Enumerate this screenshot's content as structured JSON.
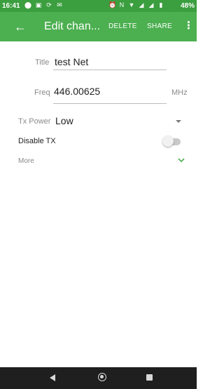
{
  "status_bar": {
    "time": "16:41",
    "battery": "48%",
    "left_icons": [
      "notification-icon",
      "image-icon",
      "sync-icon",
      "message-icon"
    ],
    "right_icons": [
      "alarm-icon",
      "nfc-icon",
      "wifi-icon",
      "signal-icon",
      "signal-icon",
      "battery-icon"
    ]
  },
  "app_bar": {
    "title": "Edit chan...",
    "back_icon": "arrow-back-icon",
    "actions": {
      "delete": "DELETE",
      "share": "SHARE"
    },
    "overflow_icon": "more-vert-icon",
    "color": "#4caf50"
  },
  "form": {
    "title": {
      "label": "Title",
      "value": "test Net"
    },
    "freq": {
      "label": "Freq",
      "value": "446.00625",
      "unit": "MHz"
    },
    "tx_power": {
      "label": "Tx Power",
      "value": "Low"
    },
    "disable_tx": {
      "label": "Disable TX",
      "enabled": false
    },
    "more": {
      "label": "More",
      "icon": "chevron-down-icon",
      "color": "#4caf50"
    }
  },
  "nav_bar": {
    "buttons": [
      "back",
      "home",
      "recents"
    ]
  }
}
